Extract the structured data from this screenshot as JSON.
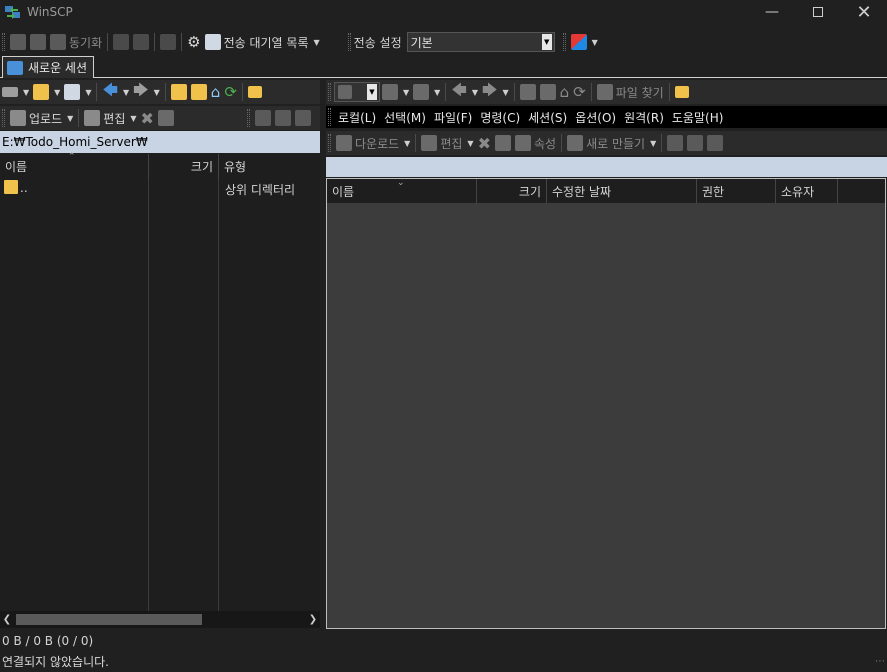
{
  "window": {
    "title": "WinSCP",
    "minimize_icon": "minimize-icon",
    "maximize_icon": "maximize-icon",
    "close_icon": "close-icon"
  },
  "main_toolbar": {
    "sync_label": "동기화",
    "queue_label": "전송 대기열 목록",
    "transfer_settings_label": "전송 설정",
    "transfer_preset": "기본"
  },
  "session_tab": {
    "label": "새로운 세션"
  },
  "left_panel": {
    "upload_label": "업로드",
    "edit_label": "편집",
    "path": "E:₩Todo_Homi_Server₩",
    "columns": [
      "이름",
      "크기",
      "유형"
    ],
    "rows": [
      {
        "name": "..",
        "size": "",
        "type": "상위 디렉터리"
      }
    ],
    "summary": "0 B / 0 B (0 / 0)"
  },
  "right_panel": {
    "find_files_label": "파일 찾기",
    "menu": [
      "로컬(L)",
      "선택(M)",
      "파일(F)",
      "명령(C)",
      "세션(S)",
      "옵션(O)",
      "원격(R)",
      "도움말(H)"
    ],
    "download_label": "다운로드",
    "edit_label": "편집",
    "properties_label": "속성",
    "new_label": "새로 만들기",
    "path": "",
    "columns": [
      "이름",
      "크기",
      "수정한 날짜",
      "권한",
      "소유자"
    ]
  },
  "status": {
    "text": "연결되지 않았습니다."
  },
  "colors": {
    "background": "#202020",
    "toolbar": "#2b2b2b",
    "path_bar": "#c8d4e3",
    "file_area_left": "#1e1e1e",
    "file_area_right": "#3c3c3c"
  }
}
